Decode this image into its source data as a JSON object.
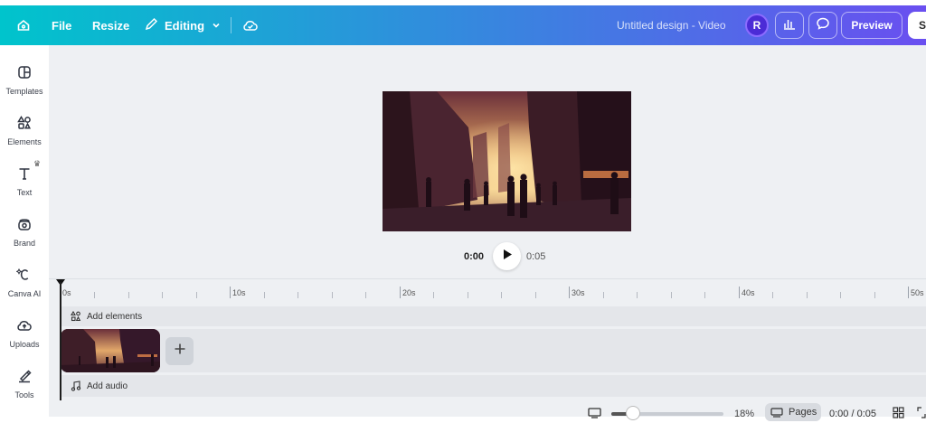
{
  "topbar": {
    "file_label": "File",
    "resize_label": "Resize",
    "editing_label": "Editing",
    "doc_title": "Untitled design - Video",
    "avatar_initial": "R",
    "preview_label": "Preview",
    "share_label_partial": "S"
  },
  "sidebar": {
    "items": [
      {
        "label": "Templates",
        "icon": "templates-icon"
      },
      {
        "label": "Elements",
        "icon": "elements-icon"
      },
      {
        "label": "Text",
        "icon": "text-icon"
      },
      {
        "label": "Brand",
        "icon": "brand-icon"
      },
      {
        "label": "Canva AI",
        "icon": "canva-ai-icon"
      },
      {
        "label": "Uploads",
        "icon": "uploads-icon"
      },
      {
        "label": "Tools",
        "icon": "tools-icon"
      }
    ]
  },
  "player": {
    "current_time": "0:00",
    "duration": "0:05"
  },
  "timeline": {
    "ruler_labels": [
      "0s",
      "10s",
      "20s",
      "30s",
      "40s",
      "50s"
    ],
    "add_elements_label": "Add elements",
    "add_audio_label": "Add audio"
  },
  "statusbar": {
    "zoom": "18%",
    "pages_label": "Pages",
    "time_readout": "0:00 / 0:05"
  },
  "colors": {
    "topbar_gradient_start": "#00c4cc",
    "topbar_gradient_end": "#6a4ff0",
    "avatar_bg": "#4b2bd6"
  }
}
